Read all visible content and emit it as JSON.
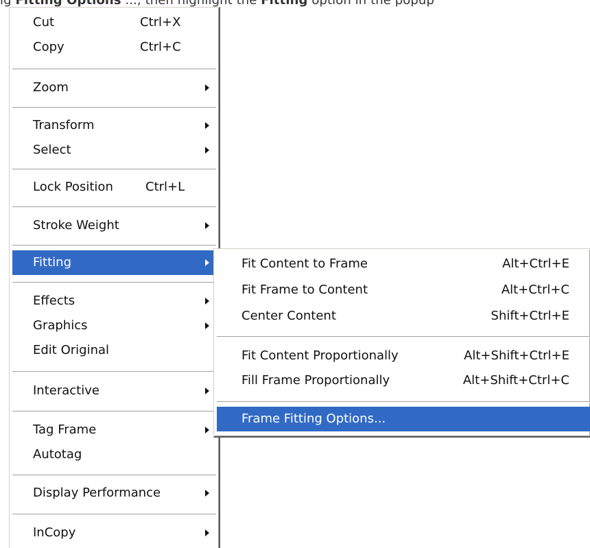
{
  "caption": {
    "prefix": "ig",
    "bold1": "Fitting Options",
    "mid": " ..., then highlight the ",
    "bold2": "Fitting",
    "suffix": " option in the popup"
  },
  "context_menu": {
    "items": [
      {
        "label": "Cut",
        "shortcut": "Ctrl+X"
      },
      {
        "label": "Copy",
        "shortcut": "Ctrl+C"
      },
      {
        "label": "Zoom"
      },
      {
        "label": "Transform"
      },
      {
        "label": "Select"
      },
      {
        "label": "Lock Position",
        "shortcut": "Ctrl+L"
      },
      {
        "label": "Stroke Weight"
      },
      {
        "label": "Fitting"
      },
      {
        "label": "Effects"
      },
      {
        "label": "Graphics"
      },
      {
        "label": "Edit Original"
      },
      {
        "label": "Interactive"
      },
      {
        "label": "Tag Frame"
      },
      {
        "label": "Autotag"
      },
      {
        "label": "Display Performance"
      },
      {
        "label": "InCopy"
      }
    ]
  },
  "fitting_submenu": {
    "items": [
      {
        "label": "Fit Content to Frame",
        "shortcut": "Alt+Ctrl+E"
      },
      {
        "label": "Fit Frame to Content",
        "shortcut": "Alt+Ctrl+C"
      },
      {
        "label": "Center Content",
        "shortcut": "Shift+Ctrl+E"
      },
      {
        "label": "Fit Content Proportionally",
        "shortcut": "Alt+Shift+Ctrl+E"
      },
      {
        "label": "Fill Frame Proportionally",
        "shortcut": "Alt+Shift+Ctrl+C"
      },
      {
        "label": "Frame Fitting Options..."
      }
    ]
  },
  "colors": {
    "highlight": "#316ac5",
    "highlight_text": "#ffffff",
    "menu_background": "#ffffff"
  }
}
